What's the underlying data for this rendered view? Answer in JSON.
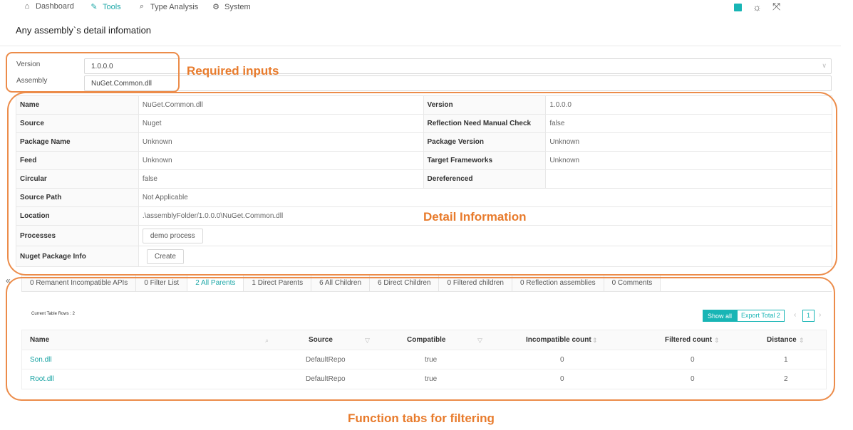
{
  "nav": {
    "items": [
      {
        "label": "Dashboard",
        "icon": "home-icon"
      },
      {
        "label": "Tools",
        "icon": "wrench-icon"
      },
      {
        "label": "Type Analysis",
        "icon": "search-icon"
      },
      {
        "label": "System",
        "icon": "gear-icon"
      }
    ],
    "active": "Tools"
  },
  "page": {
    "title": "Any assembly`s detail infomation"
  },
  "inputs": {
    "version_label": "Version",
    "version_value": "1.0.0.0",
    "assembly_label": "Assembly",
    "assembly_value": "NuGet.Common.dll"
  },
  "annotations": {
    "required": "Required inputs",
    "detail": "Detail Information",
    "tabs": "Function tabs for filtering"
  },
  "detail": {
    "name_label": "Name",
    "name_value": "NuGet.Common.dll",
    "version_label": "Version",
    "version_value": "1.0.0.0",
    "source_label": "Source",
    "source_value": "Nuget",
    "reflection_label": "Reflection Need Manual Check",
    "reflection_value": "false",
    "package_name_label": "Package Name",
    "package_name_value": "Unknown",
    "package_version_label": "Package Version",
    "package_version_value": "Unknown",
    "feed_label": "Feed",
    "feed_value": "Unknown",
    "target_frameworks_label": "Target Frameworks",
    "target_frameworks_value": "Unknown",
    "circular_label": "Circular",
    "circular_value": "false",
    "dereferenced_label": "Dereferenced",
    "dereferenced_value": "",
    "source_path_label": "Source Path",
    "source_path_value": "Not Applicable",
    "location_label": "Location",
    "location_value": ".\\assemblyFolder/1.0.0.0\\NuGet.Common.dll",
    "processes_label": "Processes",
    "processes_button": "demo process",
    "nuget_info_label": "Nuget Package Info",
    "nuget_info_button": "Create"
  },
  "tabs": [
    "0 Remanent Incompatible APIs",
    "0 Filter List",
    "2 All Parents",
    "1 Direct Parents",
    "6 All Children",
    "6 Direct Children",
    "0 Filtered children",
    "0 Reflection assemblies",
    "0 Comments"
  ],
  "active_tab": "2 All Parents",
  "table_meta": {
    "rows_label": "Current Table Rows : 2",
    "show_all": "Show all",
    "export": "Export Total 2",
    "page": "1"
  },
  "table": {
    "headers": [
      "Name",
      "Source",
      "Compatible",
      "Incompatible count",
      "Filtered count",
      "Distance"
    ],
    "rows": [
      [
        "Son.dll",
        "DefaultRepo",
        "true",
        "0",
        "0",
        "1"
      ],
      [
        "Root.dll",
        "DefaultRepo",
        "true",
        "0",
        "0",
        "2"
      ]
    ]
  },
  "colors": {
    "accent": "#18b5b5",
    "annotation": "#ec8c4a"
  }
}
